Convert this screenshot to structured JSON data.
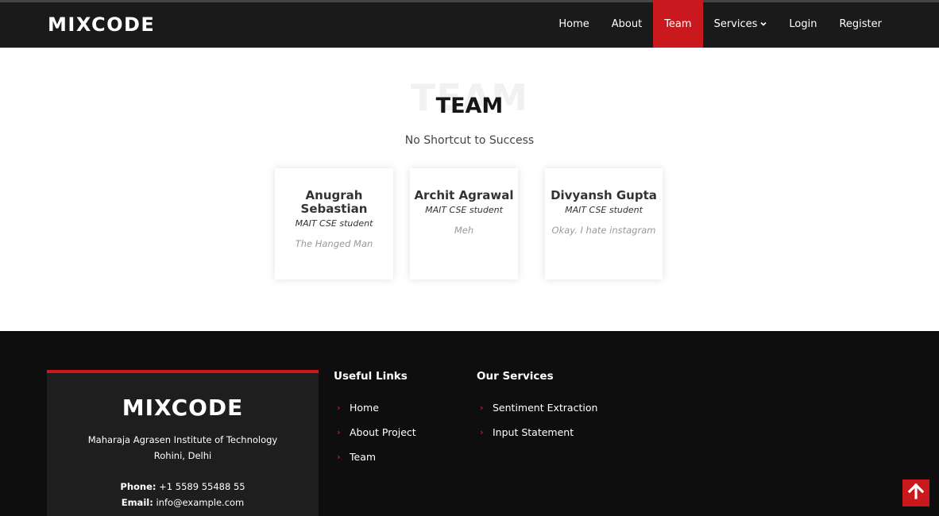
{
  "header": {
    "logo": "MIXCODE",
    "nav": [
      {
        "label": "Home",
        "active": false
      },
      {
        "label": "About",
        "active": false
      },
      {
        "label": "Team",
        "active": true
      },
      {
        "label": "Services",
        "active": false,
        "dropdown": true
      },
      {
        "label": "Login",
        "active": false
      },
      {
        "label": "Register",
        "active": false
      }
    ]
  },
  "team": {
    "bg_title": "TEAM",
    "title": "TEAM",
    "subtitle": "No Shortcut to Success",
    "members": [
      {
        "name": "Anugrah Sebastian",
        "role": "MAIT CSE student",
        "quote": "The Hanged Man"
      },
      {
        "name": "Archit Agrawal",
        "role": "MAIT CSE student",
        "quote": "Meh"
      },
      {
        "name": "Divyansh Gupta",
        "role": "MAIT CSE student",
        "quote": "Okay. I hate instagram"
      }
    ]
  },
  "footer": {
    "logo": "MIXCODE",
    "address_line1": "Maharaja Agrasen Institute of Technology",
    "address_line2": "Rohini, Delhi",
    "phone_label": "Phone:",
    "phone": "+1 5589 55488 55",
    "email_label": "Email:",
    "email": "info@example.com",
    "useful_links_title": "Useful Links",
    "useful_links": [
      "Home",
      "About Project",
      "Team"
    ],
    "services_title": "Our Services",
    "services": [
      "Sentiment Extraction",
      "Input Statement"
    ]
  },
  "colors": {
    "accent": "#c9191e",
    "header_bg": "#1a1a1a",
    "footer_bg": "#0e0e0e",
    "footer_card_bg": "#1e1e1e"
  },
  "icons": {
    "dropdown": "chevron-down-icon",
    "link_bullet": "chevron-right-icon",
    "back_to_top": "arrow-up-icon"
  }
}
